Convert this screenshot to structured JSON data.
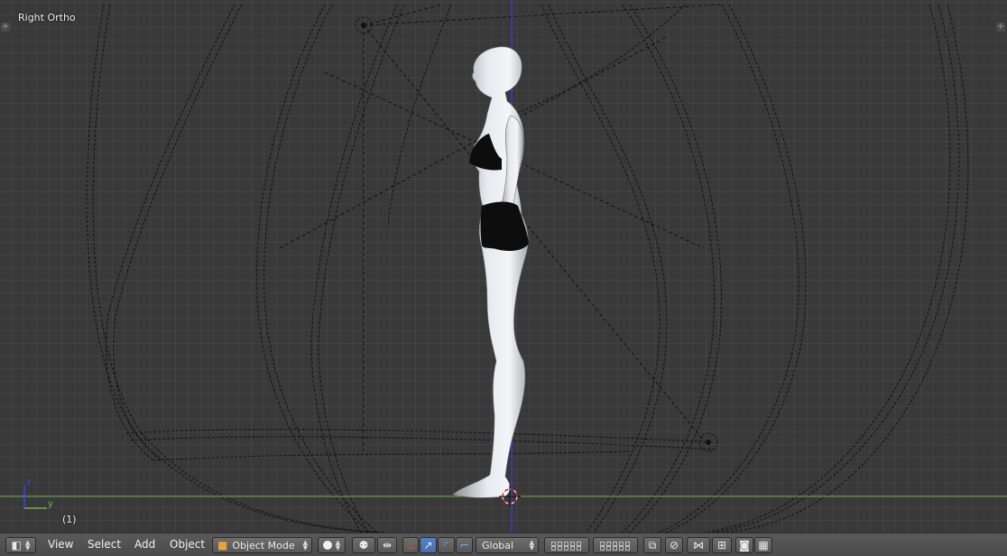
{
  "viewport": {
    "view_name": "Right Ortho",
    "frame": "(1)",
    "axis_z": "z",
    "axis_y": "y"
  },
  "header": {
    "menus": [
      {
        "label": "View"
      },
      {
        "label": "Select"
      },
      {
        "label": "Add"
      },
      {
        "label": "Object"
      }
    ],
    "mode": "Object Mode",
    "orientation": "Global",
    "icons": {
      "editor_type": "cube-icon",
      "shading": "solid-sphere-icon",
      "pivot": "pivot-icon",
      "manipulator": "manipulator-toggle-icon",
      "translate": "arrow-icon",
      "rotate": "arc-icon",
      "scale": "scale-icon",
      "layers": "layers-grid-icon",
      "lock": "lock-icon",
      "proportional": "proportional-edit-icon",
      "snap": "magnet-icon",
      "snap_element": "snap-element-icon",
      "snap_target": "snap-target-icon",
      "render": "camera-icon",
      "anim": "clapper-icon"
    }
  },
  "colors": {
    "viewport_bg": "#393939",
    "x_axis": "#6fb04a",
    "z_axis": "#3d3dff",
    "header_bg": "#4f4f4f"
  }
}
